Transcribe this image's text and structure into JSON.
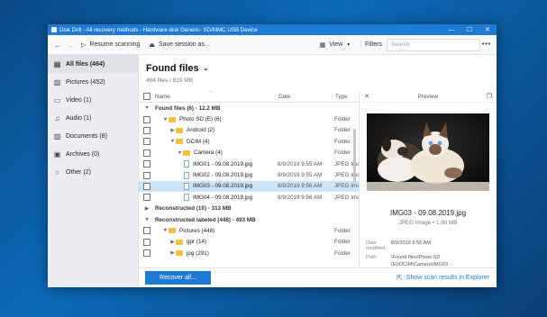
{
  "window": {
    "title": "Disk Drill - All recovery methods - Hardware disk Generic- SD/MMC USB Device",
    "controls": [
      "—",
      "☐",
      "✕"
    ]
  },
  "toolbar": {
    "resume_label": "Resume scanning",
    "save_label": "Save session as...",
    "view_label": "View",
    "filters_label": "Filters",
    "search_placeholder": "Search",
    "more_label": "•••"
  },
  "sidebar": {
    "items": [
      {
        "label": "All files (464)",
        "icon": "all-files-icon",
        "glyph": "▤"
      },
      {
        "label": "Pictures (452)",
        "icon": "pictures-icon",
        "glyph": "▨"
      },
      {
        "label": "Video (1)",
        "icon": "video-icon",
        "glyph": "▭"
      },
      {
        "label": "Audio (1)",
        "icon": "audio-icon",
        "glyph": "♫"
      },
      {
        "label": "Documents (8)",
        "icon": "documents-icon",
        "glyph": "▥"
      },
      {
        "label": "Archives (0)",
        "icon": "archives-icon",
        "glyph": "▣"
      },
      {
        "label": "Other (2)",
        "icon": "other-icon",
        "glyph": "○"
      }
    ]
  },
  "main": {
    "title": "Found files",
    "subtitle": "464 files / 819 MB"
  },
  "table": {
    "columns": {
      "name": "Name",
      "date": "Date",
      "type": "Type"
    },
    "rows": [
      {
        "kind": "group",
        "indent": 0,
        "name": "Found files (6) - 12.2 MB",
        "date": "",
        "type": "",
        "expand": "▼"
      },
      {
        "kind": "folder",
        "indent": 1,
        "name": "Photo SD (E) (6)",
        "date": "",
        "type": "Folder",
        "expand": "▼"
      },
      {
        "kind": "folder",
        "indent": 2,
        "name": "Android (2)",
        "date": "",
        "type": "Folder",
        "expand": "▶"
      },
      {
        "kind": "folder",
        "indent": 2,
        "name": "DCIM (4)",
        "date": "",
        "type": "Folder",
        "expand": "▼"
      },
      {
        "kind": "folder",
        "indent": 3,
        "name": "Camera (4)",
        "date": "",
        "type": "Folder",
        "expand": "▼"
      },
      {
        "kind": "file",
        "indent": 4,
        "name": "IMG01 - 09.08.2019.jpg",
        "date": "8/9/2019 9:55 AM",
        "type": "JPEG Image",
        "expand": ""
      },
      {
        "kind": "file",
        "indent": 4,
        "name": "IMG02 - 09.08.2019.jpg",
        "date": "8/9/2019 9:55 AM",
        "type": "JPEG Image",
        "expand": ""
      },
      {
        "kind": "file",
        "indent": 4,
        "name": "IMG03 - 09.08.2019.jpg",
        "date": "8/9/2019 9:56 AM",
        "type": "JPEG Image",
        "expand": "",
        "selected": true
      },
      {
        "kind": "file",
        "indent": 4,
        "name": "IMG04 - 09.08.2019.jpg",
        "date": "8/9/2019 9:56 AM",
        "type": "JPEG Image",
        "expand": ""
      },
      {
        "kind": "group",
        "indent": 0,
        "name": "Reconstructed (10) - 313 MB",
        "date": "",
        "type": "",
        "expand": "▶"
      },
      {
        "kind": "group",
        "indent": 0,
        "name": "Reconstructed labeled (448) - 493 MB",
        "date": "",
        "type": "",
        "expand": "▼"
      },
      {
        "kind": "folder",
        "indent": 1,
        "name": "Pictures (448)",
        "date": "",
        "type": "Folder",
        "expand": "▼"
      },
      {
        "kind": "folder",
        "indent": 2,
        "name": "gpr (14)",
        "date": "",
        "type": "Folder",
        "expand": "▶"
      },
      {
        "kind": "folder",
        "indent": 2,
        "name": "jpg (291)",
        "date": "",
        "type": "Folder",
        "expand": "▶"
      }
    ]
  },
  "preview": {
    "header": "Preview",
    "file_name": "IMG03 - 09.08.2019.jpg",
    "file_info": "JPEG Image • 1.90 MB",
    "date_modified_label": "Date modified:",
    "date_modified": "8/9/2019 9:56 AM",
    "path_label": "Path:",
    "path": "\\Found files\\Photo SD (E)\\DCIM\\Camera\\IMG03 - 09.08.2019.jpg"
  },
  "footer": {
    "recover_label": "Recover all...",
    "explorer_label": "Show scan results in Explorer"
  },
  "colors": {
    "accent": "#1f7ad3",
    "selection": "#cce3f8",
    "sidebar_bg": "#eceef1"
  }
}
